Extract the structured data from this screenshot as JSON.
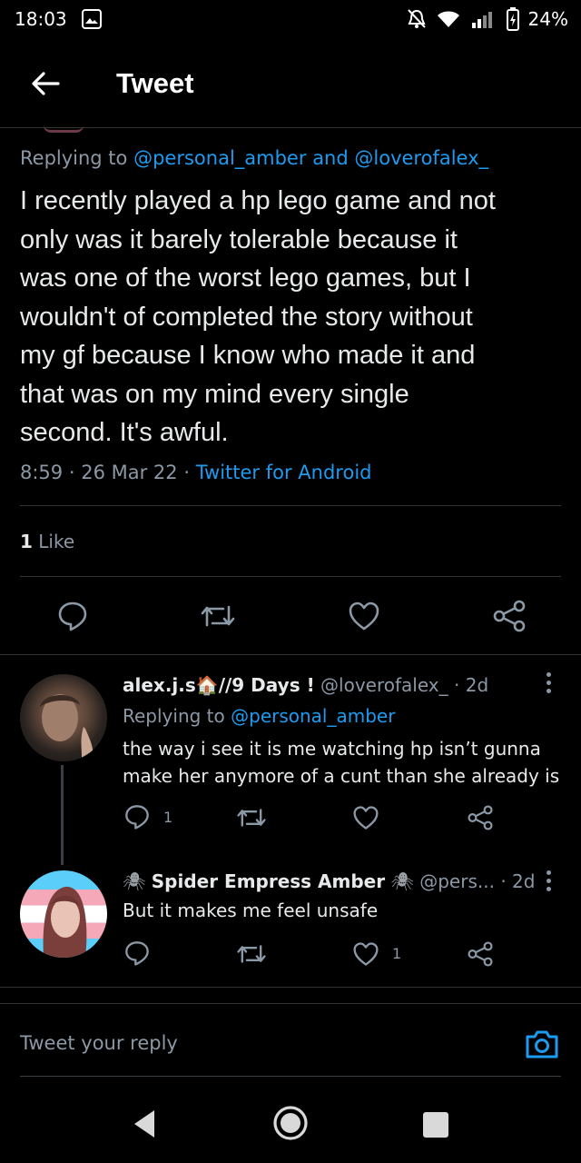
{
  "status_bar": {
    "time": "18:03",
    "battery": "24%",
    "icons": [
      "gallery-icon",
      "bell-muted-icon",
      "wifi-icon",
      "signal-icon",
      "battery-icon"
    ]
  },
  "header": {
    "title": "Tweet",
    "back_icon": "arrow-left-icon"
  },
  "tweet": {
    "replying_prefix": "Replying to",
    "replying_user1": "@personal_amber",
    "replying_and": "and",
    "replying_user2": "@loverofalex_",
    "text_lines": [
      "I recently played a hp lego game and not",
      "only was it barely tolerable because it",
      "was one of the worst lego games, but I",
      "wouldn't of completed the story without",
      "my gf because I know who made it and",
      "that was on my mind every single",
      "second. It's awful."
    ],
    "time": "8:59",
    "date": "26 Mar 22",
    "source": "Twitter for Android",
    "like_count": "1",
    "like_label": "Like"
  },
  "replies": [
    {
      "display_name": "alex.j.s",
      "name_suffix": "//9 Days !",
      "handle": "@loverofalex_",
      "age": "2d",
      "replying_prefix": "Replying to",
      "replying_user": "@personal_amber",
      "text_lines": [
        "the way i see it is me watching hp isn’t gunna",
        "make her anymore of a cunt than she already is"
      ],
      "reply_count": "1",
      "like_count": ""
    },
    {
      "display_name": "Spider Empress Amber",
      "handle": "@pers...",
      "age": "2d",
      "text_lines": [
        "But it makes me feel unsafe"
      ],
      "reply_count": "",
      "like_count": "1"
    }
  ],
  "reply_bar": {
    "placeholder": "Tweet your reply"
  },
  "colors": {
    "background": "#000000",
    "accent": "#1d9bf0",
    "text": "#e7e9ea",
    "secondary": "#8b98a5"
  }
}
